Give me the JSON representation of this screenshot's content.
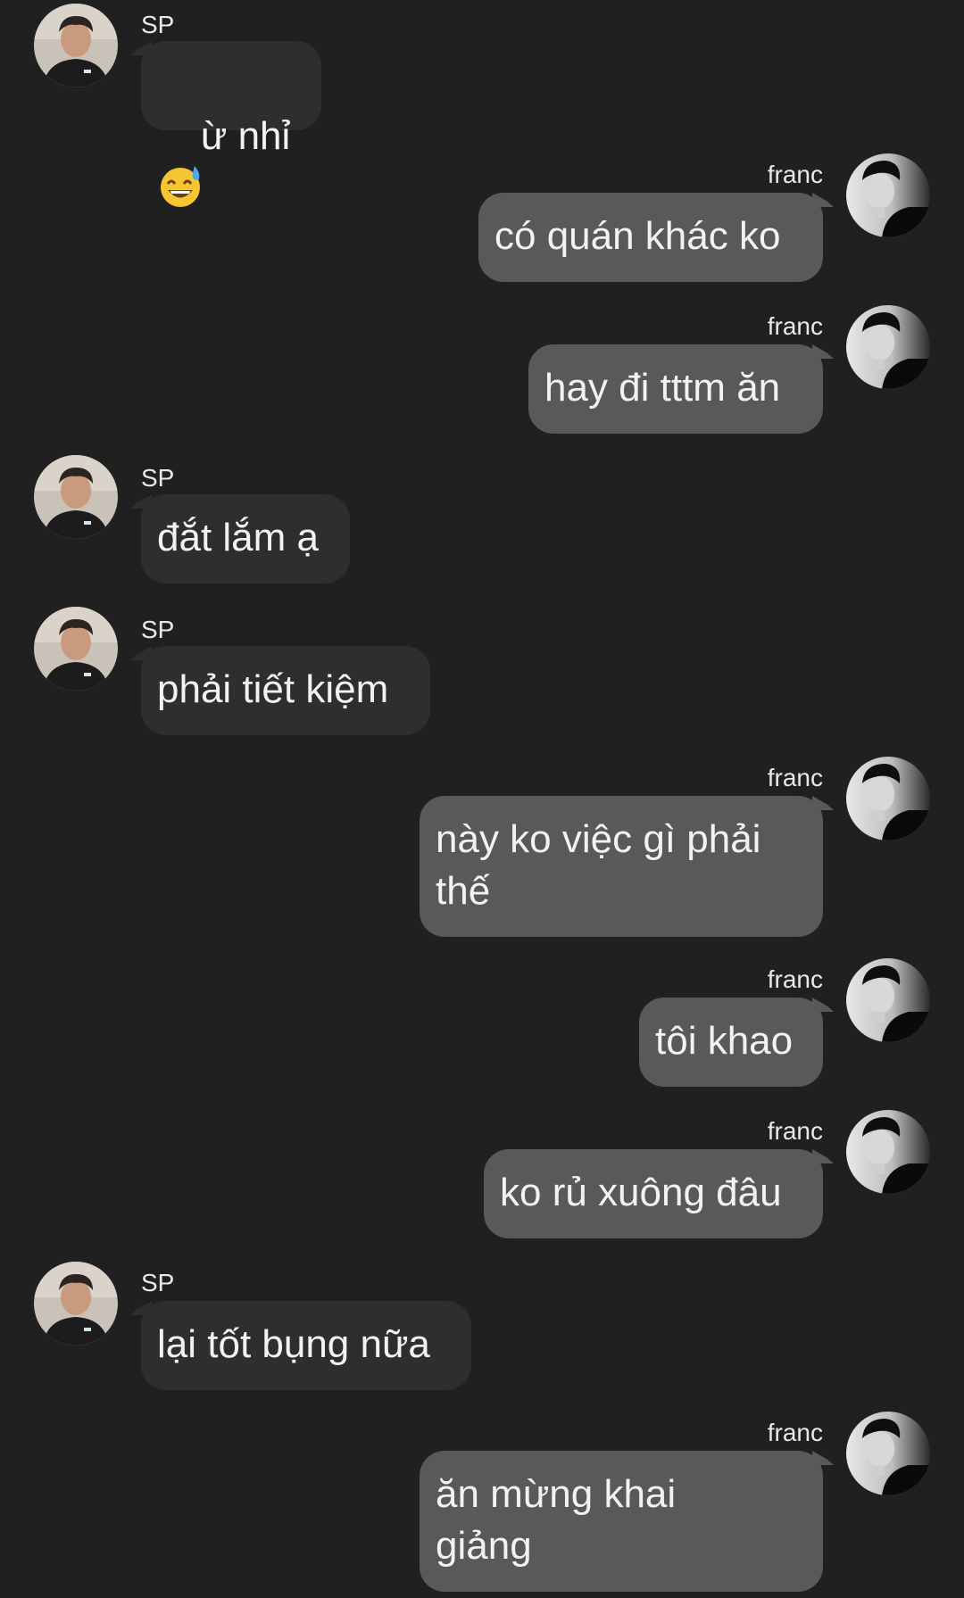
{
  "messages": [
    {
      "sender": "SP",
      "dir": "in",
      "text": "ừ nhỉ",
      "emoji": "sweat-smile-emoji"
    },
    {
      "sender": "franc",
      "dir": "out",
      "text": "có quán khác ko"
    },
    {
      "sender": "franc",
      "dir": "out",
      "text": "hay đi tttm ăn"
    },
    {
      "sender": "SP",
      "dir": "in",
      "text": "đắt lắm ạ"
    },
    {
      "sender": "SP",
      "dir": "in",
      "text": "phải tiết kiệm"
    },
    {
      "sender": "franc",
      "dir": "out",
      "text": "này ko việc gì phải\nthế"
    },
    {
      "sender": "franc",
      "dir": "out",
      "text": "tôi khao"
    },
    {
      "sender": "franc",
      "dir": "out",
      "text": "ko rủ xuông đâu"
    },
    {
      "sender": "SP",
      "dir": "in",
      "text": "lại tốt bụng nữa"
    },
    {
      "sender": "franc",
      "dir": "out",
      "text": "ăn mừng khai\ngiảng"
    }
  ],
  "colors": {
    "background": "#202020",
    "incoming_bubble": "#2e2e2e",
    "outgoing_bubble": "#595959",
    "text": "#f2f2f2"
  }
}
